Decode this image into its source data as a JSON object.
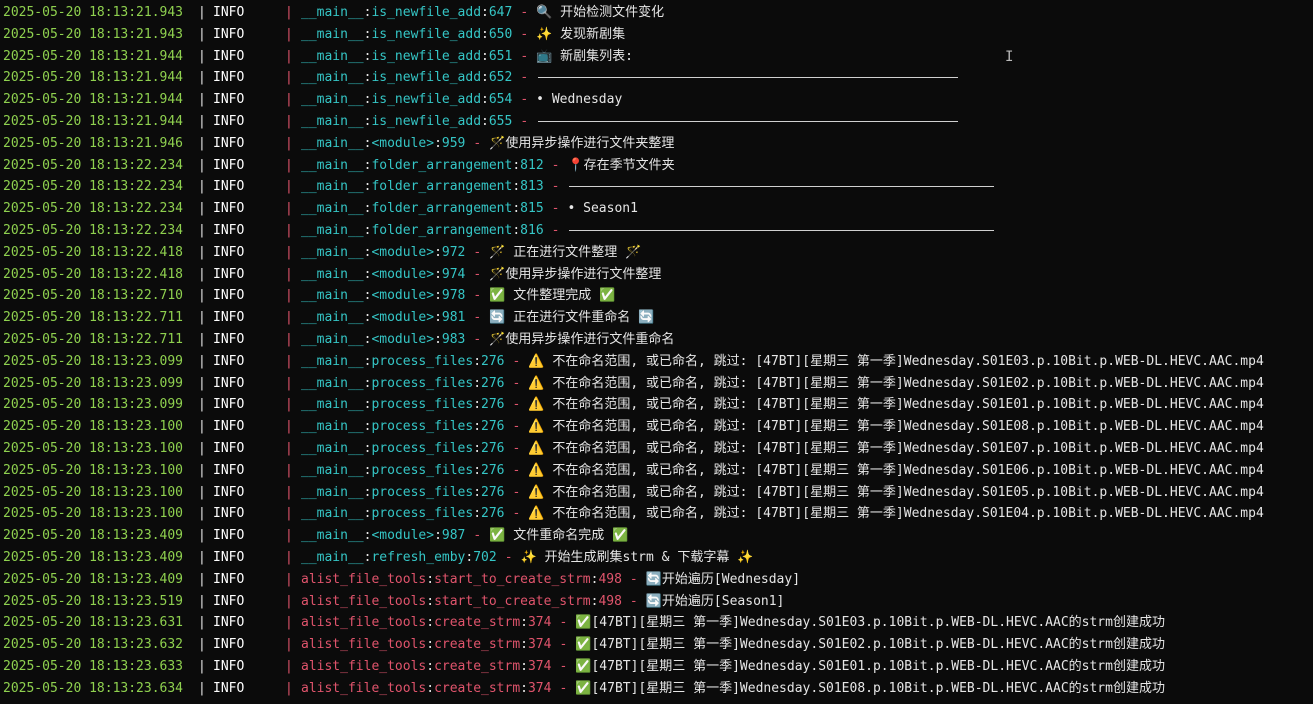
{
  "terminal": {
    "cursor_glyph": "I",
    "separator": "|",
    "dash": "-",
    "lines": [
      {
        "ts": "2025-05-20 18:13:21.943",
        "level": "INFO",
        "mod": "__main__",
        "func": "is_newfile_add",
        "lineno": "647",
        "msg": "🔍 开始检测文件变化"
      },
      {
        "ts": "2025-05-20 18:13:21.943",
        "level": "INFO",
        "mod": "__main__",
        "func": "is_newfile_add",
        "lineno": "650",
        "msg": "✨ 发现新剧集"
      },
      {
        "ts": "2025-05-20 18:13:21.944",
        "level": "INFO",
        "mod": "__main__",
        "func": "is_newfile_add",
        "lineno": "651",
        "msg": "📺 新剧集列表:"
      },
      {
        "ts": "2025-05-20 18:13:21.944",
        "level": "INFO",
        "mod": "__main__",
        "func": "is_newfile_add",
        "lineno": "652",
        "msg": "",
        "ruler": 1
      },
      {
        "ts": "2025-05-20 18:13:21.944",
        "level": "INFO",
        "mod": "__main__",
        "func": "is_newfile_add",
        "lineno": "654",
        "msg": "• Wednesday"
      },
      {
        "ts": "2025-05-20 18:13:21.944",
        "level": "INFO",
        "mod": "__main__",
        "func": "is_newfile_add",
        "lineno": "655",
        "msg": "",
        "ruler": 1
      },
      {
        "ts": "2025-05-20 18:13:21.946",
        "level": "INFO",
        "mod": "__main__",
        "func": "<module>",
        "lineno": "959",
        "msg": "🪄使用异步操作进行文件夹整理"
      },
      {
        "ts": "2025-05-20 18:13:22.234",
        "level": "INFO",
        "mod": "__main__",
        "func": "folder_arrangement",
        "lineno": "812",
        "msg": "📍存在季节文件夹"
      },
      {
        "ts": "2025-05-20 18:13:22.234",
        "level": "INFO",
        "mod": "__main__",
        "func": "folder_arrangement",
        "lineno": "813",
        "msg": "",
        "ruler": 1
      },
      {
        "ts": "2025-05-20 18:13:22.234",
        "level": "INFO",
        "mod": "__main__",
        "func": "folder_arrangement",
        "lineno": "815",
        "msg": "• Season1"
      },
      {
        "ts": "2025-05-20 18:13:22.234",
        "level": "INFO",
        "mod": "__main__",
        "func": "folder_arrangement",
        "lineno": "816",
        "msg": "",
        "ruler": 1
      },
      {
        "ts": "2025-05-20 18:13:22.418",
        "level": "INFO",
        "mod": "__main__",
        "func": "<module>",
        "lineno": "972",
        "msg": "🪄 正在进行文件整理 🪄"
      },
      {
        "ts": "2025-05-20 18:13:22.418",
        "level": "INFO",
        "mod": "__main__",
        "func": "<module>",
        "lineno": "974",
        "msg": "🪄使用异步操作进行文件整理"
      },
      {
        "ts": "2025-05-20 18:13:22.710",
        "level": "INFO",
        "mod": "__main__",
        "func": "<module>",
        "lineno": "978",
        "msg": "✅ 文件整理完成 ✅"
      },
      {
        "ts": "2025-05-20 18:13:22.711",
        "level": "INFO",
        "mod": "__main__",
        "func": "<module>",
        "lineno": "981",
        "msg": "🔄 正在进行文件重命名 🔄"
      },
      {
        "ts": "2025-05-20 18:13:22.711",
        "level": "INFO",
        "mod": "__main__",
        "func": "<module>",
        "lineno": "983",
        "msg": "🪄使用异步操作进行文件重命名"
      },
      {
        "ts": "2025-05-20 18:13:23.099",
        "level": "INFO",
        "mod": "__main__",
        "func": "process_files",
        "lineno": "276",
        "msg": "⚠️ 不在命名范围, 或已命名, 跳过: [47BT][星期三 第一季]Wednesday.S01E03.p.10Bit.p.WEB-DL.HEVC.AAC.mp4"
      },
      {
        "ts": "2025-05-20 18:13:23.099",
        "level": "INFO",
        "mod": "__main__",
        "func": "process_files",
        "lineno": "276",
        "msg": "⚠️ 不在命名范围, 或已命名, 跳过: [47BT][星期三 第一季]Wednesday.S01E02.p.10Bit.p.WEB-DL.HEVC.AAC.mp4"
      },
      {
        "ts": "2025-05-20 18:13:23.099",
        "level": "INFO",
        "mod": "__main__",
        "func": "process_files",
        "lineno": "276",
        "msg": "⚠️ 不在命名范围, 或已命名, 跳过: [47BT][星期三 第一季]Wednesday.S01E01.p.10Bit.p.WEB-DL.HEVC.AAC.mp4"
      },
      {
        "ts": "2025-05-20 18:13:23.100",
        "level": "INFO",
        "mod": "__main__",
        "func": "process_files",
        "lineno": "276",
        "msg": "⚠️ 不在命名范围, 或已命名, 跳过: [47BT][星期三 第一季]Wednesday.S01E08.p.10Bit.p.WEB-DL.HEVC.AAC.mp4"
      },
      {
        "ts": "2025-05-20 18:13:23.100",
        "level": "INFO",
        "mod": "__main__",
        "func": "process_files",
        "lineno": "276",
        "msg": "⚠️ 不在命名范围, 或已命名, 跳过: [47BT][星期三 第一季]Wednesday.S01E07.p.10Bit.p.WEB-DL.HEVC.AAC.mp4"
      },
      {
        "ts": "2025-05-20 18:13:23.100",
        "level": "INFO",
        "mod": "__main__",
        "func": "process_files",
        "lineno": "276",
        "msg": "⚠️ 不在命名范围, 或已命名, 跳过: [47BT][星期三 第一季]Wednesday.S01E06.p.10Bit.p.WEB-DL.HEVC.AAC.mp4"
      },
      {
        "ts": "2025-05-20 18:13:23.100",
        "level": "INFO",
        "mod": "__main__",
        "func": "process_files",
        "lineno": "276",
        "msg": "⚠️ 不在命名范围, 或已命名, 跳过: [47BT][星期三 第一季]Wednesday.S01E05.p.10Bit.p.WEB-DL.HEVC.AAC.mp4"
      },
      {
        "ts": "2025-05-20 18:13:23.100",
        "level": "INFO",
        "mod": "__main__",
        "func": "process_files",
        "lineno": "276",
        "msg": "⚠️ 不在命名范围, 或已命名, 跳过: [47BT][星期三 第一季]Wednesday.S01E04.p.10Bit.p.WEB-DL.HEVC.AAC.mp4"
      },
      {
        "ts": "2025-05-20 18:13:23.409",
        "level": "INFO",
        "mod": "__main__",
        "func": "<module>",
        "lineno": "987",
        "msg": "✅ 文件重命名完成 ✅"
      },
      {
        "ts": "2025-05-20 18:13:23.409",
        "level": "INFO",
        "mod": "__main__",
        "func": "refresh_emby",
        "lineno": "702",
        "msg": "✨ 开始生成刷集strm & 下载字幕 ✨"
      },
      {
        "ts": "2025-05-20 18:13:23.409",
        "level": "INFO",
        "mod": "alist_file_tools",
        "func": "start_to_create_strm",
        "lineno": "498",
        "msg": "🔄开始遍历[Wednesday]",
        "alist": 1
      },
      {
        "ts": "2025-05-20 18:13:23.519",
        "level": "INFO",
        "mod": "alist_file_tools",
        "func": "start_to_create_strm",
        "lineno": "498",
        "msg": "🔄开始遍历[Season1]",
        "alist": 1
      },
      {
        "ts": "2025-05-20 18:13:23.631",
        "level": "INFO",
        "mod": "alist_file_tools",
        "func": "create_strm",
        "lineno": "374",
        "msg": "✅[47BT][星期三 第一季]Wednesday.S01E03.p.10Bit.p.WEB-DL.HEVC.AAC的strm创建成功",
        "alist": 1
      },
      {
        "ts": "2025-05-20 18:13:23.632",
        "level": "INFO",
        "mod": "alist_file_tools",
        "func": "create_strm",
        "lineno": "374",
        "msg": "✅[47BT][星期三 第一季]Wednesday.S01E02.p.10Bit.p.WEB-DL.HEVC.AAC的strm创建成功",
        "alist": 1
      },
      {
        "ts": "2025-05-20 18:13:23.633",
        "level": "INFO",
        "mod": "alist_file_tools",
        "func": "create_strm",
        "lineno": "374",
        "msg": "✅[47BT][星期三 第一季]Wednesday.S01E01.p.10Bit.p.WEB-DL.HEVC.AAC的strm创建成功",
        "alist": 1
      },
      {
        "ts": "2025-05-20 18:13:23.634",
        "level": "INFO",
        "mod": "alist_file_tools",
        "func": "create_strm",
        "lineno": "374",
        "msg": "✅[47BT][星期三 第一季]Wednesday.S01E08.p.10Bit.p.WEB-DL.HEVC.AAC的strm创建成功",
        "alist": 1
      }
    ]
  }
}
